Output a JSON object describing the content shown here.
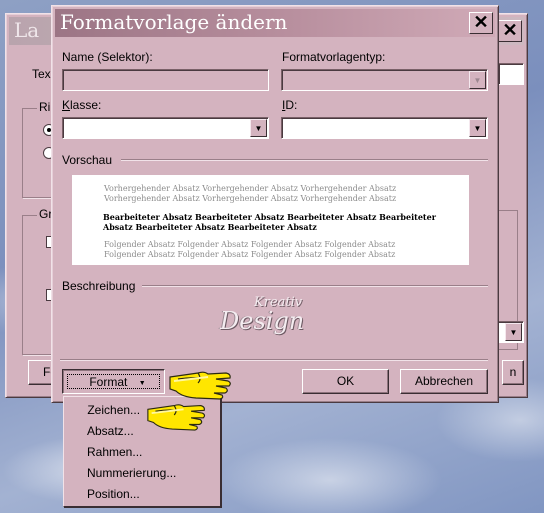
{
  "back_window": {
    "title_partial": "La",
    "label_text_partial": "Tex",
    "group1_label_partial": "Ri",
    "group2_label_partial": "Gr",
    "footer_button_partial": "Fo",
    "footer_button_right_partial": "n",
    "close_symbol": "✕"
  },
  "dialog": {
    "title": "Formatvorlage ändern",
    "close_symbol": "✕",
    "name_label": "Name (Selektor):",
    "name_value": "",
    "type_label": "Formatvorlagentyp:",
    "type_value": "",
    "class_label": "Klasse:",
    "class_value": "",
    "id_label": "ID:",
    "id_value": "",
    "preview_label": "Vorschau",
    "preview": {
      "prev_line1": "Vorhergehender Absatz Vorhergehender Absatz Vorhergehender Absatz",
      "prev_line2": "Vorhergehender Absatz Vorhergehender Absatz Vorhergehender Absatz",
      "cur_line1": "Bearbeiteter Absatz Bearbeiteter Absatz Bearbeiteter Absatz Bearbeiteter",
      "cur_line2": "Absatz Bearbeiteter Absatz Bearbeiteter Absatz",
      "next_line1": "Folgender Absatz Folgender Absatz Folgender Absatz Folgender Absatz",
      "next_line2": "Folgender Absatz Folgender Absatz Folgender Absatz Folgender Absatz"
    },
    "description_label": "Beschreibung",
    "watermark_line1": "Kreativ",
    "watermark_line2": "Design",
    "format_button": "Format",
    "format_arrow": "▼",
    "ok_button": "OK",
    "cancel_button": "Abbrechen"
  },
  "format_menu": {
    "items": [
      "Zeichen...",
      "Absatz...",
      "Rahmen...",
      "Nummerierung...",
      "Position..."
    ]
  },
  "colors": {
    "dialog_bg": "#d4b3bf",
    "titlebar_start": "#9c7585",
    "titlebar_end": "#d0aab7",
    "pointer_hand": "#ffe600"
  },
  "icons": {
    "pointer": "pointing-hand-icon",
    "close": "close-icon",
    "dropdown": "chevron-down-icon"
  }
}
